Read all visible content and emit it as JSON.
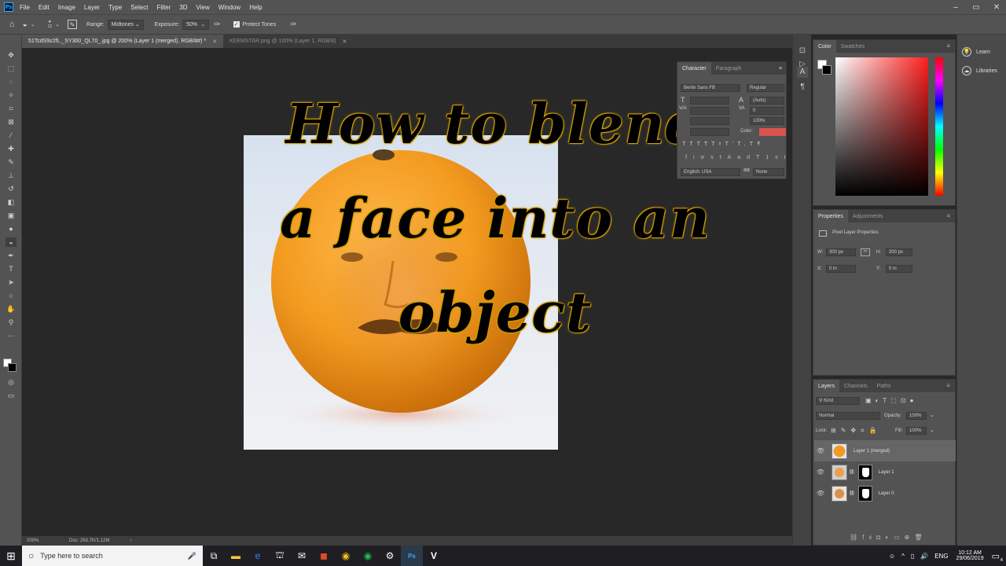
{
  "menubar": {
    "logo": "Ps",
    "items": [
      "File",
      "Edit",
      "Image",
      "Layer",
      "Type",
      "Select",
      "Filter",
      "3D",
      "View",
      "Window",
      "Help"
    ],
    "window_controls": [
      "–",
      "▭",
      "✕"
    ]
  },
  "options": {
    "brush_size": "12",
    "range_label": "Range:",
    "range_value": "Midtones",
    "exposure_label": "Exposure:",
    "exposure_value": "50%",
    "protect_tones_label": "Protect Tones"
  },
  "tabs": [
    {
      "label": "51TcdS9z2fL._SY300_QL70_.jpg @ 200% (Layer 1 (merged), RGB/8#) *"
    },
    {
      "label": "KEEMSTAR.png @ 100% (Layer 1, RGB/8)"
    }
  ],
  "canvas": {
    "headline_lines": [
      "How to blend",
      "a face into an",
      "object"
    ]
  },
  "status": {
    "zoom": "200%",
    "doc": "Doc: 263.7K/1.12M"
  },
  "character": {
    "tabs": [
      "Character",
      "Paragraph"
    ],
    "font_family": "Berlin Sans FB",
    "font_style": "Regular",
    "leading": "(Auto)",
    "tracking": "0",
    "scale": "100%",
    "color_label": "Color:",
    "color": "#d9534f",
    "language": "English: USA",
    "antialias": "None"
  },
  "color_panel": {
    "tabs": [
      "Color",
      "Swatches"
    ]
  },
  "learn_panel": {
    "items": [
      "Learn",
      "Libraries"
    ]
  },
  "properties": {
    "tabs": [
      "Properties",
      "Adjustments"
    ],
    "title": "Pixel Layer Properties",
    "w_label": "W:",
    "w": "300 px",
    "h_label": "H:",
    "h": "300 px",
    "x_label": "X:",
    "x": "0 in",
    "y_label": "Y:",
    "y": "0 in"
  },
  "layers": {
    "tabs": [
      "Layers",
      "Channels",
      "Paths"
    ],
    "filter": "Kind",
    "blend_mode": "Normal",
    "opacity_label": "Opacity:",
    "opacity": "100%",
    "lock_label": "Lock:",
    "fill_label": "Fill:",
    "fill": "100%",
    "items": [
      {
        "name": "Layer 1 (merged)"
      },
      {
        "name": "Layer 1"
      },
      {
        "name": "Layer 0"
      }
    ]
  },
  "taskbar": {
    "search_placeholder": "Type here to search",
    "lang": "ENG",
    "time": "10:12 AM",
    "date": "29/06/2019",
    "notifications": "4"
  }
}
